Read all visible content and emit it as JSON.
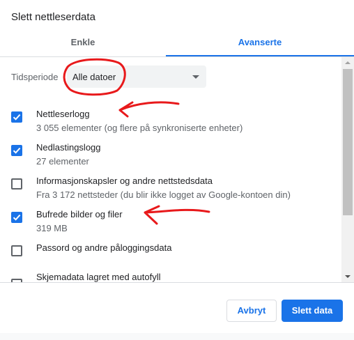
{
  "dialog": {
    "title": "Slett nettleserdata"
  },
  "tabs": [
    {
      "label": "Enkle",
      "selected": false
    },
    {
      "label": "Avanserte",
      "selected": true
    }
  ],
  "time_range": {
    "label": "Tidsperiode",
    "value": "Alle datoer"
  },
  "options": [
    {
      "title": "Nettleserlogg",
      "subtitle": "3 055 elementer (og flere på synkroniserte enheter)",
      "checked": true
    },
    {
      "title": "Nedlastingslogg",
      "subtitle": "27 elementer",
      "checked": true
    },
    {
      "title": "Informasjonskapsler og andre nettstedsdata",
      "subtitle": "Fra 3 172 nettsteder (du blir ikke logget av Google-kontoen din)",
      "checked": false
    },
    {
      "title": "Bufrede bilder og filer",
      "subtitle": "319 MB",
      "checked": true
    },
    {
      "title": "Passord og andre påloggingsdata",
      "subtitle": "",
      "checked": false
    },
    {
      "title": "Skjemadata lagret med autofyll",
      "subtitle": "",
      "checked": false
    }
  ],
  "buttons": {
    "cancel": "Avbryt",
    "confirm": "Slett data"
  },
  "colors": {
    "accent": "#1a73e8",
    "annotation": "#e8191b"
  }
}
